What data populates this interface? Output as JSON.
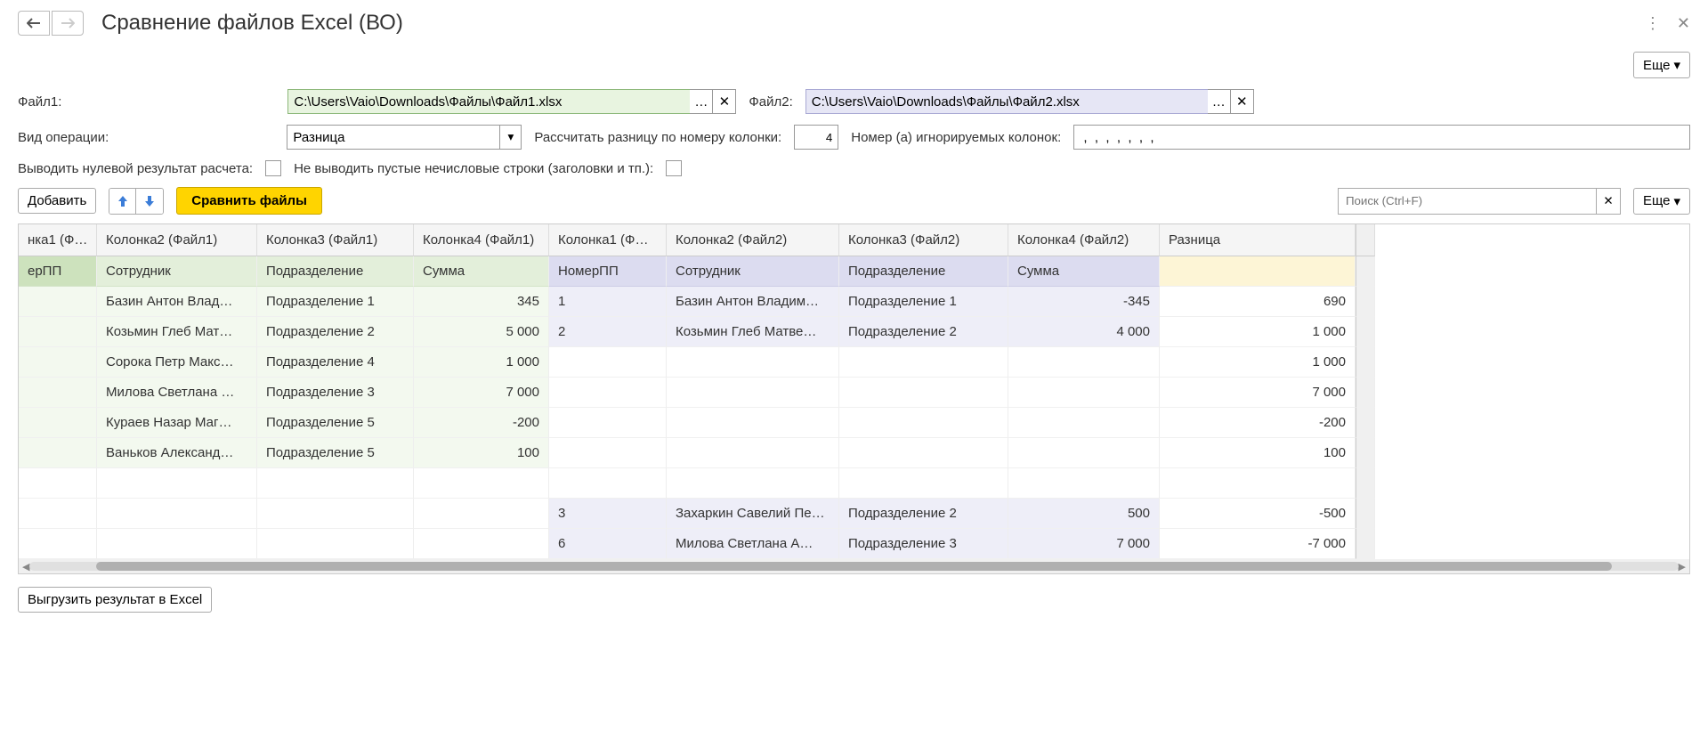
{
  "title": "Сравнение файлов Excel (ВО)",
  "eshe": "Еще",
  "labels": {
    "file1": "Файл1:",
    "file2": "Файл2:",
    "operation": "Вид операции:",
    "calcByCol": "Рассчитать разницу по номеру колонки:",
    "ignoreCols": "Номер (а) игнорируемых колонок:",
    "zeroResult": "Выводить нулевой результат расчета:",
    "emptyRows": "Не выводить пустые нечисловые строки (заголовки и тп.):"
  },
  "file1Path": "C:\\Users\\Vaio\\Downloads\\Файлы\\Файл1.xlsx",
  "file2Path": "C:\\Users\\Vaio\\Downloads\\Файлы\\Файл2.xlsx",
  "operation": "Разница",
  "calcCol": "4",
  "ignoreVal": " ,  ,  ,  ,  ,  ,  ,",
  "toolbar": {
    "add": "Добавить",
    "compare": "Сравнить файлы",
    "searchPlaceholder": "Поиск (Ctrl+F)",
    "export": "Выгрузить результат в Excel"
  },
  "columns": [
    "нка1 (Ф…",
    "Колонка2 (Файл1)",
    "Колонка3 (Файл1)",
    "Колонка4 (Файл1)",
    "Колонка1 (Ф…",
    "Колонка2 (Файл2)",
    "Колонка3 (Файл2)",
    "Колонка4 (Файл2)",
    "Разница"
  ],
  "headRow": [
    "ерПП",
    "Сотрудник",
    "Подразделение",
    "Сумма",
    "НомерПП",
    "Сотрудник",
    "Подразделение",
    "Сумма",
    ""
  ],
  "rows": [
    {
      "f1": [
        "",
        "Базин Антон Влад…",
        "Подразделение 1",
        "345"
      ],
      "f2": [
        "1",
        "Базин Антон Владим…",
        "Подразделение 1",
        "-345"
      ],
      "diff": "690"
    },
    {
      "f1": [
        "",
        "Козьмин Глеб Мат…",
        "Подразделение 2",
        "5 000"
      ],
      "f2": [
        "2",
        "Козьмин Глеб Матве…",
        "Подразделение 2",
        "4 000"
      ],
      "diff": "1 000"
    },
    {
      "f1": [
        "",
        "Сорока Петр Макс…",
        "Подразделение 4",
        "1 000"
      ],
      "f2": [
        "",
        "",
        "",
        ""
      ],
      "diff": "1 000"
    },
    {
      "f1": [
        "",
        "Милова Светлана …",
        "Подразделение 3",
        "7 000"
      ],
      "f2": [
        "",
        "",
        "",
        ""
      ],
      "diff": "7 000"
    },
    {
      "f1": [
        "",
        "Кураев Назар Маг…",
        "Подразделение 5",
        "-200"
      ],
      "f2": [
        "",
        "",
        "",
        ""
      ],
      "diff": "-200"
    },
    {
      "f1": [
        "",
        "Ваньков Александ…",
        "Подразделение 5",
        "100"
      ],
      "f2": [
        "",
        "",
        "",
        ""
      ],
      "diff": "100"
    },
    {
      "f1": [
        "",
        "",
        "",
        ""
      ],
      "f2": [
        "",
        "",
        "",
        ""
      ],
      "diff": ""
    },
    {
      "f1": [
        "",
        "",
        "",
        ""
      ],
      "f2": [
        "3",
        "Захаркин Савелий Пе…",
        "Подразделение 2",
        "500"
      ],
      "diff": "-500"
    },
    {
      "f1": [
        "",
        "",
        "",
        ""
      ],
      "f2": [
        "6",
        "Милова Светлана А…",
        "Подразделение 3",
        "7 000"
      ],
      "diff": "-7 000"
    }
  ]
}
